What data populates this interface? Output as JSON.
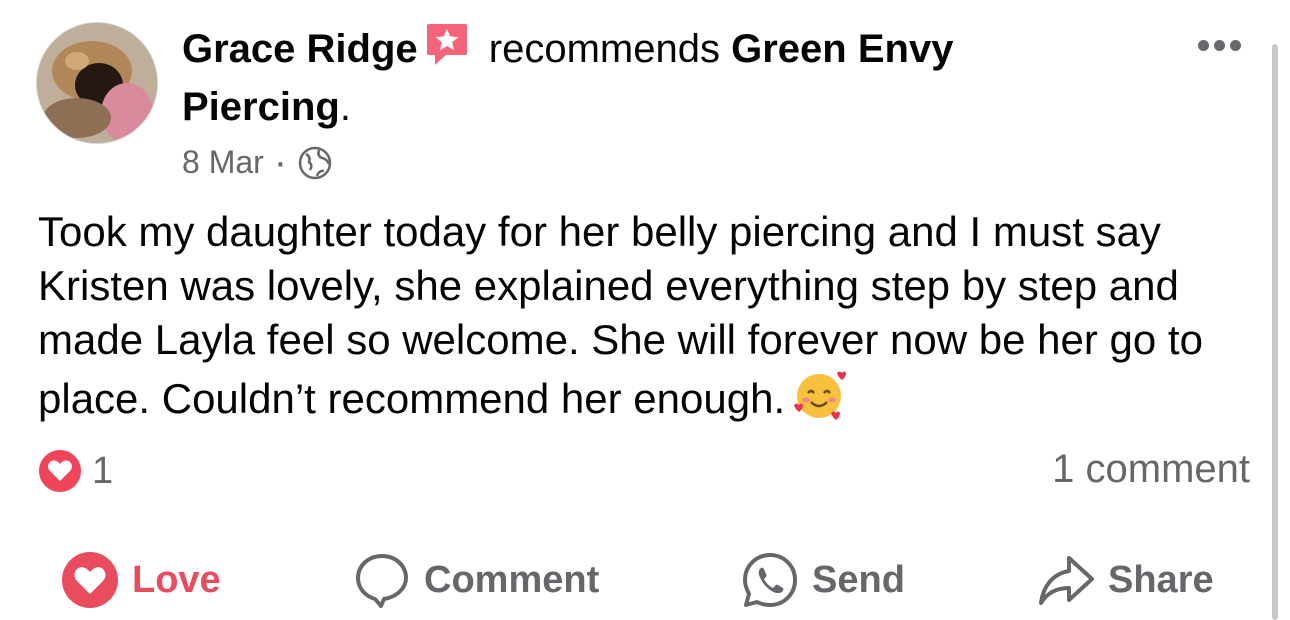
{
  "post": {
    "author": "Grace Ridge",
    "recommends_text": "recommends",
    "page": "Green Envy Piercing",
    "page_suffix": ".",
    "date": "8 Mar",
    "separator": "·",
    "audience_icon": "globe-icon",
    "body": "Took my daughter today for her belly piercing and I must say Kristen was lovely, she explained everything step by step and made Layla feel so welcome. She will forever now be her go to place. Couldn’t recommend her enough.",
    "emoji": "smiling-face-with-hearts"
  },
  "reactions": {
    "icon": "love-reaction-icon",
    "count": "1",
    "comments": "1 comment"
  },
  "actions": {
    "love": "Love",
    "comment": "Comment",
    "send": "Send",
    "share": "Share"
  },
  "colors": {
    "love": "#e94b5f",
    "secondary_text": "#65676b",
    "recommend_badge": "#f5647a"
  }
}
